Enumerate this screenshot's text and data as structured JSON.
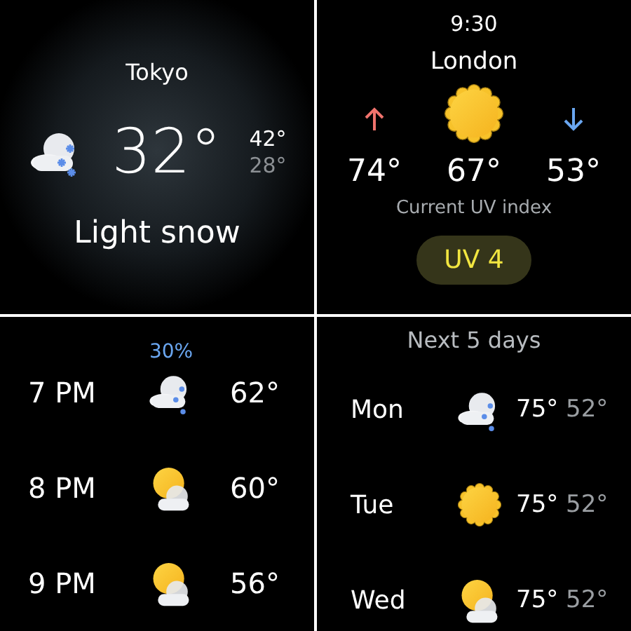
{
  "current": {
    "city": "Tokyo",
    "kind": "snow",
    "temp": "32°",
    "high": "42°",
    "low": "28°",
    "condition": "Light snow"
  },
  "uv": {
    "time": "9:30",
    "city": "London",
    "kind": "sunny",
    "high": "74°",
    "current": "67°",
    "low": "53°",
    "label": "Current UV index",
    "uv": "UV 4"
  },
  "hourly": [
    {
      "time": "7 PM",
      "precip": "30%",
      "kind": "rain",
      "temp": "62°"
    },
    {
      "time": "8 PM",
      "kind": "partly_cloudy",
      "temp": "60°"
    },
    {
      "time": "9 PM",
      "kind": "partly_cloudy",
      "temp": "56°"
    }
  ],
  "daily": {
    "title": "Next 5 days",
    "rows": [
      {
        "day": "Mon",
        "kind": "rain",
        "high": "75°",
        "low": "52°"
      },
      {
        "day": "Tue",
        "kind": "sunny",
        "high": "75°",
        "low": "52°"
      },
      {
        "day": "Wed",
        "kind": "partly_cloudy",
        "high": "75°",
        "low": "52°"
      }
    ]
  }
}
